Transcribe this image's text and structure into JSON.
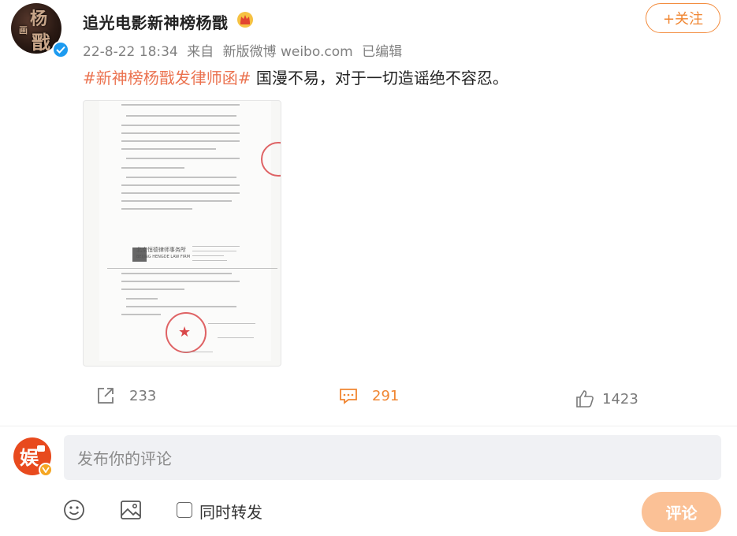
{
  "post": {
    "author": "追光电影新神榜杨戬",
    "date": "22-8-22 18:34",
    "source_prefix": "来自",
    "source": "新版微博 weibo.com",
    "edited": "已编辑",
    "follow_label": "+关注",
    "hashtag": "#新神榜杨戬发律师函#",
    "text": " 国漫不易，对于一切造谣绝不容忍。",
    "attachment": {
      "firm_name": "北京恒德律师事务所",
      "firm_name_en": "BEIJING HENGDE LAW FIRM"
    }
  },
  "actions": {
    "repost_count": "233",
    "comment_count": "291",
    "like_count": "1423"
  },
  "comment": {
    "placeholder": "发布你的评论",
    "repost_label": "同时转发",
    "submit_label": "评论"
  },
  "colors": {
    "accent": "#eb7350",
    "follow": "#f08632",
    "submit_disabled": "#fbc196",
    "verified": "#1d9bf0"
  },
  "icons": [
    "verified-icon",
    "crown-icon",
    "repost-icon",
    "comment-icon",
    "like-icon",
    "emoji-icon",
    "image-icon"
  ]
}
